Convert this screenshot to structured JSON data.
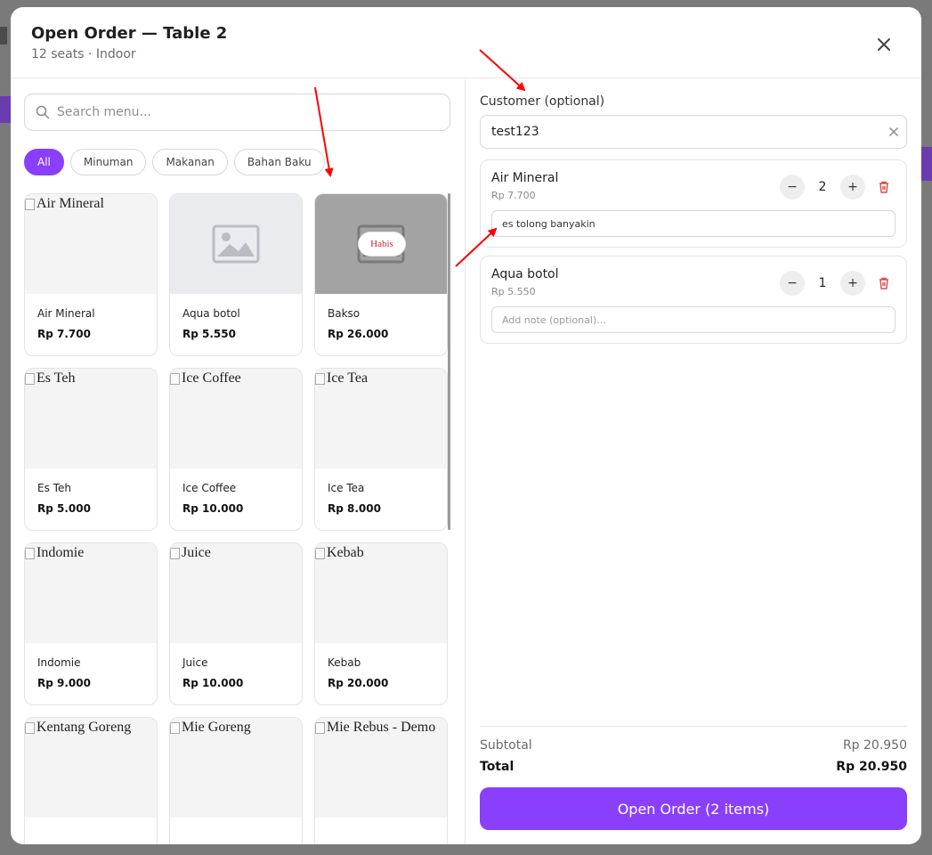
{
  "modal": {
    "title": "Open Order — Table 2",
    "subtitle": "12 seats · Indoor",
    "close_icon": "close-icon"
  },
  "search": {
    "placeholder": "Search menu..."
  },
  "categories": [
    {
      "label": "All",
      "active": true
    },
    {
      "label": "Minuman",
      "active": false
    },
    {
      "label": "Makanan",
      "active": false
    },
    {
      "label": "Bahan Baku",
      "active": false
    }
  ],
  "menu_items": [
    {
      "name": "Air Mineral",
      "price": "Rp 7.700",
      "image": "broken",
      "alt": "Air Mineral"
    },
    {
      "name": "Aqua botol",
      "price": "Rp 5.550",
      "image": "placeholder"
    },
    {
      "name": "Bakso",
      "price": "Rp 26.000",
      "image": "soldout",
      "badge": "Habis"
    },
    {
      "name": "Es Teh",
      "price": "Rp 5.000",
      "image": "broken",
      "alt": "Es Teh"
    },
    {
      "name": "Ice Coffee",
      "price": "Rp 10.000",
      "image": "broken",
      "alt": "Ice Coffee"
    },
    {
      "name": "Ice Tea",
      "price": "Rp 8.000",
      "image": "broken",
      "alt": "Ice Tea"
    },
    {
      "name": "Indomie",
      "price": "Rp 9.000",
      "image": "broken",
      "alt": "Indomie"
    },
    {
      "name": "Juice",
      "price": "Rp 10.000",
      "image": "broken",
      "alt": "Juice"
    },
    {
      "name": "Kebab",
      "price": "Rp 20.000",
      "image": "broken",
      "alt": "Kebab"
    },
    {
      "name": "",
      "price": "",
      "image": "broken",
      "alt": "Kentang Goreng"
    },
    {
      "name": "",
      "price": "",
      "image": "broken",
      "alt": "Mie Goreng"
    },
    {
      "name": "",
      "price": "",
      "image": "broken",
      "alt": "Mie Rebus - Demo"
    }
  ],
  "customer": {
    "label": "Customer (optional)",
    "value": "test123"
  },
  "order_items": [
    {
      "name": "Air Mineral",
      "price": "Rp 7.700",
      "qty": "2",
      "minus": "−",
      "plus": "+",
      "note_value": "es tolong banyakin",
      "note_placeholder": "Add note (optional)..."
    },
    {
      "name": "Aqua botol",
      "price": "Rp 5.550",
      "qty": "1",
      "minus": "−",
      "plus": "+",
      "note_value": "",
      "note_placeholder": "Add note (optional)..."
    }
  ],
  "summary": {
    "subtotal_label": "Subtotal",
    "subtotal_value": "Rp 20.950",
    "total_label": "Total",
    "total_value": "Rp 20.950"
  },
  "submit_label": "Open Order (2 items)",
  "colors": {
    "accent": "#8a3ffc",
    "sold_out_text": "#c62828",
    "annotation_arrow": "#ff0000"
  }
}
